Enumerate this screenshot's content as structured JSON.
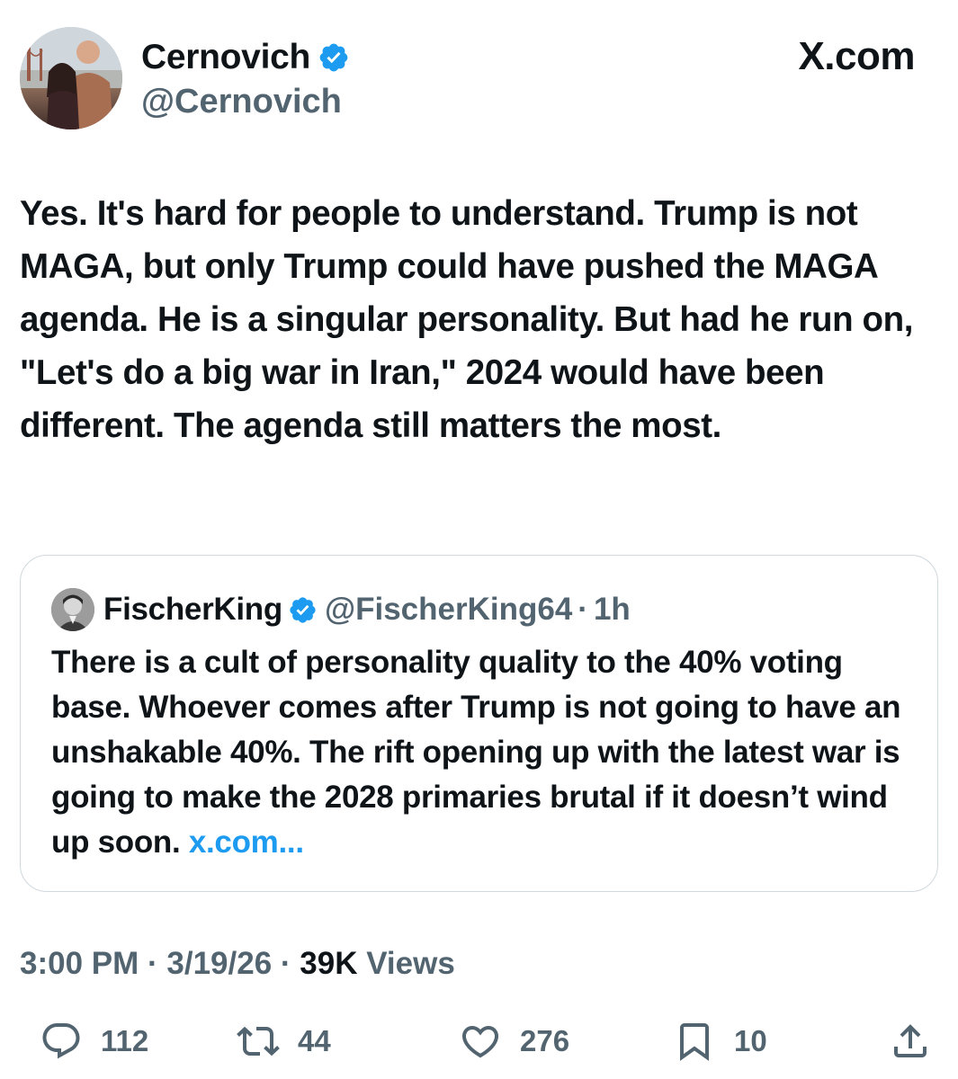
{
  "author": {
    "name": "Cernovich",
    "handle": "@Cernovich",
    "verified": true
  },
  "site": {
    "label": "X.com"
  },
  "tweet": {
    "text": "Yes. It's hard for people to understand. Trump is not MAGA, but only Trump could have pushed the MAGA agenda. He is a singular personality. But had he run on, \"Let's do a big war in Iran,\" 2024 would have been different. The agenda still matters the most."
  },
  "quote": {
    "name": "FischerKing",
    "handle": "@FischerKing64",
    "separator": "·",
    "age": "1h",
    "text": "There is a cult of personality quality to the 40% voting base. Whoever comes after Trump is not going to have an unshakable 40%. The rift opening up with the latest war is going to make the 2028 primaries brutal if it doesn’t wind up soon. ",
    "link": "x.com..."
  },
  "meta": {
    "time": "3:00 PM",
    "sep1": " · ",
    "date": "3/19/26",
    "sep2": " · ",
    "views_count": "39K",
    "views_label": " Views"
  },
  "actions": {
    "replies": "112",
    "reposts": "44",
    "likes": "276",
    "bookmarks": "10"
  },
  "icons": {
    "verified": "verified-badge-icon",
    "reply": "reply-icon",
    "repost": "repost-icon",
    "like": "heart-icon",
    "bookmark": "bookmark-icon",
    "share": "share-icon"
  },
  "colors": {
    "text": "#0f1419",
    "secondary": "#536471",
    "link": "#1d9bf0",
    "verified": "#1d9bf0",
    "border": "#cfd9de"
  }
}
